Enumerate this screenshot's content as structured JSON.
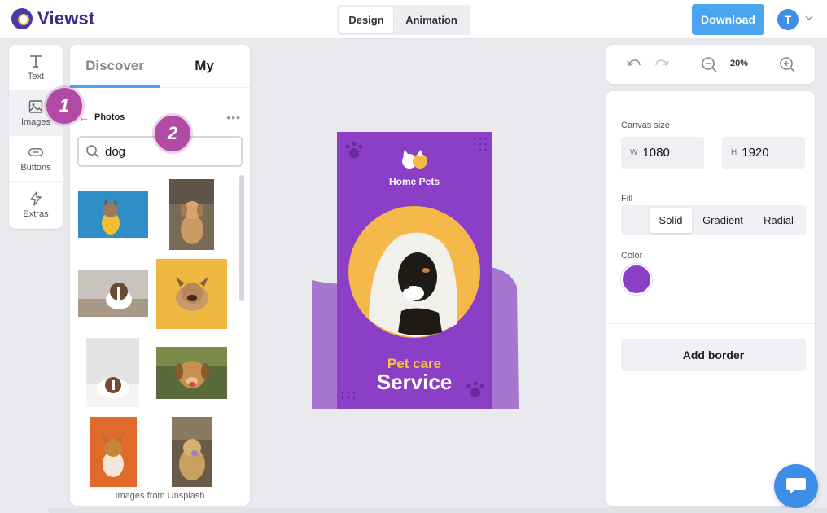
{
  "app": {
    "name": "Viewst"
  },
  "header": {
    "modes": [
      "Design",
      "Animation"
    ],
    "download_label": "Download",
    "avatar_initial": "T"
  },
  "tools": [
    {
      "label": "Text",
      "icon": "text-icon"
    },
    {
      "label": "Images",
      "icon": "image-icon"
    },
    {
      "label": "Buttons",
      "icon": "button-icon"
    },
    {
      "label": "Extras",
      "icon": "lightning-icon"
    }
  ],
  "panel": {
    "tabs": [
      "Discover",
      "My"
    ],
    "section_title": "Photos",
    "search": {
      "value": "dog",
      "placeholder": ""
    },
    "footer": "Images from Unsplash"
  },
  "markers": [
    "1",
    "2"
  ],
  "canvas_design": {
    "brand": "Home Pets",
    "headline_top": "Pet care",
    "headline_main": "Service",
    "colors": {
      "background": "#8a3fc6",
      "circle": "#f5b94a",
      "accent_text": "#f5c342",
      "shape": "#a577cf"
    }
  },
  "toolbar": {
    "zoom": "20%"
  },
  "properties": {
    "canvas_size_label": "Canvas size",
    "width_prefix": "W",
    "width": "1080",
    "height_prefix": "H",
    "height": "1920",
    "fill_label": "Fill",
    "fill_options": [
      "—",
      "Solid",
      "Gradient",
      "Radial"
    ],
    "fill_selected": "Solid",
    "color_label": "Color",
    "color_value": "#8a3fc6",
    "add_border_label": "Add border"
  }
}
